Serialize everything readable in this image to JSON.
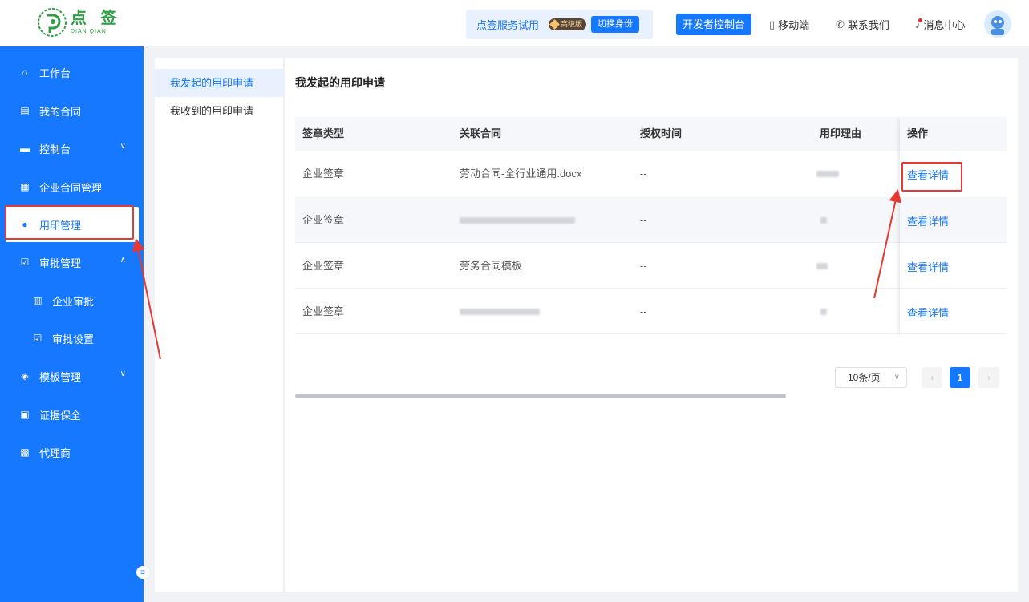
{
  "header": {
    "logo_cn": "点 签",
    "logo_en": "DIAN QIAN",
    "trial_text": "点签服务试用",
    "premium_badge": "高级版",
    "switch_identity": "切换身份",
    "dev_console": "开发者控制台",
    "mobile": "移动端",
    "contact": "联系我们",
    "messages": "消息中心"
  },
  "sidebar": {
    "items": [
      {
        "label": "工作台",
        "icon": "home-icon"
      },
      {
        "label": "我的合同",
        "icon": "document-icon"
      },
      {
        "label": "控制台",
        "icon": "console-icon"
      },
      {
        "label": "企业合同管理",
        "icon": "file-icon"
      },
      {
        "label": "用印管理",
        "icon": "seal-user-icon"
      },
      {
        "label": "审批管理",
        "icon": "approval-icon"
      },
      {
        "label": "企业审批",
        "icon": "building-icon"
      },
      {
        "label": "审批设置",
        "icon": "checkbox-icon"
      },
      {
        "label": "模板管理",
        "icon": "layers-icon"
      },
      {
        "label": "证据保全",
        "icon": "evidence-icon"
      },
      {
        "label": "代理商",
        "icon": "briefcase-icon"
      }
    ]
  },
  "left_menu": {
    "items": [
      "我发起的用印申请",
      "我收到的用印申请"
    ]
  },
  "main": {
    "title": "我发起的用印申请",
    "columns": [
      "签章类型",
      "关联合同",
      "授权时间",
      "用印理由",
      "操作"
    ],
    "rows": [
      {
        "seal_type": "企业签章",
        "contract": "劳动合同-全行业通用.docx",
        "auth_time": "--",
        "action": "查看详情"
      },
      {
        "seal_type": "企业签章",
        "contract": "",
        "auth_time": "--",
        "action": "查看详情"
      },
      {
        "seal_type": "企业签章",
        "contract": "劳务合同模板",
        "auth_time": "--",
        "action": "查看详情"
      },
      {
        "seal_type": "企业签章",
        "contract": "",
        "auth_time": "--",
        "action": "查看详情"
      }
    ]
  },
  "pagination": {
    "page_size": "10条/页",
    "current_page": "1"
  },
  "colors": {
    "primary": "#1677ff",
    "annotation": "#e53935"
  }
}
